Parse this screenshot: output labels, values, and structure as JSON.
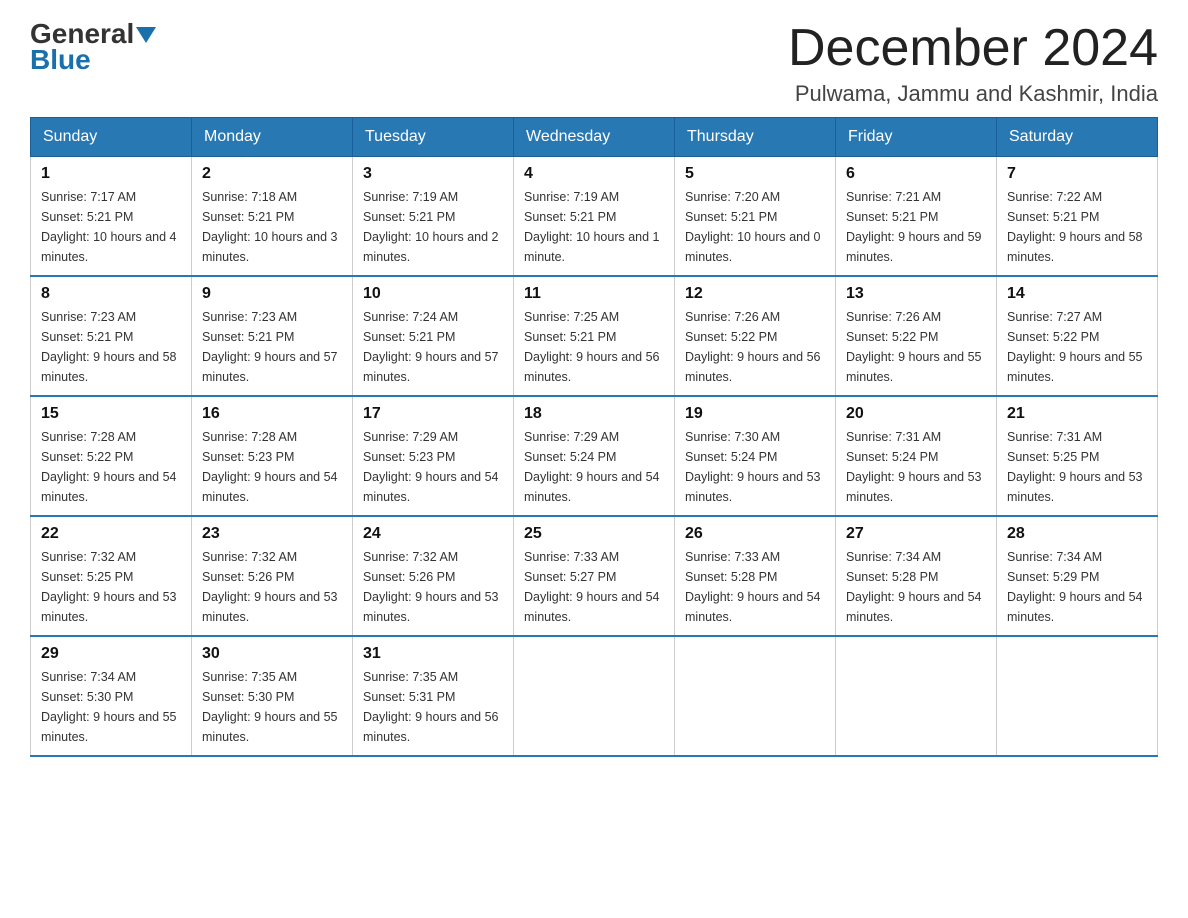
{
  "header": {
    "logo_general": "General",
    "logo_blue": "Blue",
    "month_year": "December 2024",
    "location": "Pulwama, Jammu and Kashmir, India"
  },
  "days_of_week": [
    "Sunday",
    "Monday",
    "Tuesday",
    "Wednesday",
    "Thursday",
    "Friday",
    "Saturday"
  ],
  "weeks": [
    [
      {
        "date": "1",
        "sunrise": "7:17 AM",
        "sunset": "5:21 PM",
        "daylight": "10 hours and 4 minutes."
      },
      {
        "date": "2",
        "sunrise": "7:18 AM",
        "sunset": "5:21 PM",
        "daylight": "10 hours and 3 minutes."
      },
      {
        "date": "3",
        "sunrise": "7:19 AM",
        "sunset": "5:21 PM",
        "daylight": "10 hours and 2 minutes."
      },
      {
        "date": "4",
        "sunrise": "7:19 AM",
        "sunset": "5:21 PM",
        "daylight": "10 hours and 1 minute."
      },
      {
        "date": "5",
        "sunrise": "7:20 AM",
        "sunset": "5:21 PM",
        "daylight": "10 hours and 0 minutes."
      },
      {
        "date": "6",
        "sunrise": "7:21 AM",
        "sunset": "5:21 PM",
        "daylight": "9 hours and 59 minutes."
      },
      {
        "date": "7",
        "sunrise": "7:22 AM",
        "sunset": "5:21 PM",
        "daylight": "9 hours and 58 minutes."
      }
    ],
    [
      {
        "date": "8",
        "sunrise": "7:23 AM",
        "sunset": "5:21 PM",
        "daylight": "9 hours and 58 minutes."
      },
      {
        "date": "9",
        "sunrise": "7:23 AM",
        "sunset": "5:21 PM",
        "daylight": "9 hours and 57 minutes."
      },
      {
        "date": "10",
        "sunrise": "7:24 AM",
        "sunset": "5:21 PM",
        "daylight": "9 hours and 57 minutes."
      },
      {
        "date": "11",
        "sunrise": "7:25 AM",
        "sunset": "5:21 PM",
        "daylight": "9 hours and 56 minutes."
      },
      {
        "date": "12",
        "sunrise": "7:26 AM",
        "sunset": "5:22 PM",
        "daylight": "9 hours and 56 minutes."
      },
      {
        "date": "13",
        "sunrise": "7:26 AM",
        "sunset": "5:22 PM",
        "daylight": "9 hours and 55 minutes."
      },
      {
        "date": "14",
        "sunrise": "7:27 AM",
        "sunset": "5:22 PM",
        "daylight": "9 hours and 55 minutes."
      }
    ],
    [
      {
        "date": "15",
        "sunrise": "7:28 AM",
        "sunset": "5:22 PM",
        "daylight": "9 hours and 54 minutes."
      },
      {
        "date": "16",
        "sunrise": "7:28 AM",
        "sunset": "5:23 PM",
        "daylight": "9 hours and 54 minutes."
      },
      {
        "date": "17",
        "sunrise": "7:29 AM",
        "sunset": "5:23 PM",
        "daylight": "9 hours and 54 minutes."
      },
      {
        "date": "18",
        "sunrise": "7:29 AM",
        "sunset": "5:24 PM",
        "daylight": "9 hours and 54 minutes."
      },
      {
        "date": "19",
        "sunrise": "7:30 AM",
        "sunset": "5:24 PM",
        "daylight": "9 hours and 53 minutes."
      },
      {
        "date": "20",
        "sunrise": "7:31 AM",
        "sunset": "5:24 PM",
        "daylight": "9 hours and 53 minutes."
      },
      {
        "date": "21",
        "sunrise": "7:31 AM",
        "sunset": "5:25 PM",
        "daylight": "9 hours and 53 minutes."
      }
    ],
    [
      {
        "date": "22",
        "sunrise": "7:32 AM",
        "sunset": "5:25 PM",
        "daylight": "9 hours and 53 minutes."
      },
      {
        "date": "23",
        "sunrise": "7:32 AM",
        "sunset": "5:26 PM",
        "daylight": "9 hours and 53 minutes."
      },
      {
        "date": "24",
        "sunrise": "7:32 AM",
        "sunset": "5:26 PM",
        "daylight": "9 hours and 53 minutes."
      },
      {
        "date": "25",
        "sunrise": "7:33 AM",
        "sunset": "5:27 PM",
        "daylight": "9 hours and 54 minutes."
      },
      {
        "date": "26",
        "sunrise": "7:33 AM",
        "sunset": "5:28 PM",
        "daylight": "9 hours and 54 minutes."
      },
      {
        "date": "27",
        "sunrise": "7:34 AM",
        "sunset": "5:28 PM",
        "daylight": "9 hours and 54 minutes."
      },
      {
        "date": "28",
        "sunrise": "7:34 AM",
        "sunset": "5:29 PM",
        "daylight": "9 hours and 54 minutes."
      }
    ],
    [
      {
        "date": "29",
        "sunrise": "7:34 AM",
        "sunset": "5:30 PM",
        "daylight": "9 hours and 55 minutes."
      },
      {
        "date": "30",
        "sunrise": "7:35 AM",
        "sunset": "5:30 PM",
        "daylight": "9 hours and 55 minutes."
      },
      {
        "date": "31",
        "sunrise": "7:35 AM",
        "sunset": "5:31 PM",
        "daylight": "9 hours and 56 minutes."
      },
      null,
      null,
      null,
      null
    ]
  ],
  "labels": {
    "sunrise": "Sunrise:",
    "sunset": "Sunset:",
    "daylight": "Daylight:"
  }
}
